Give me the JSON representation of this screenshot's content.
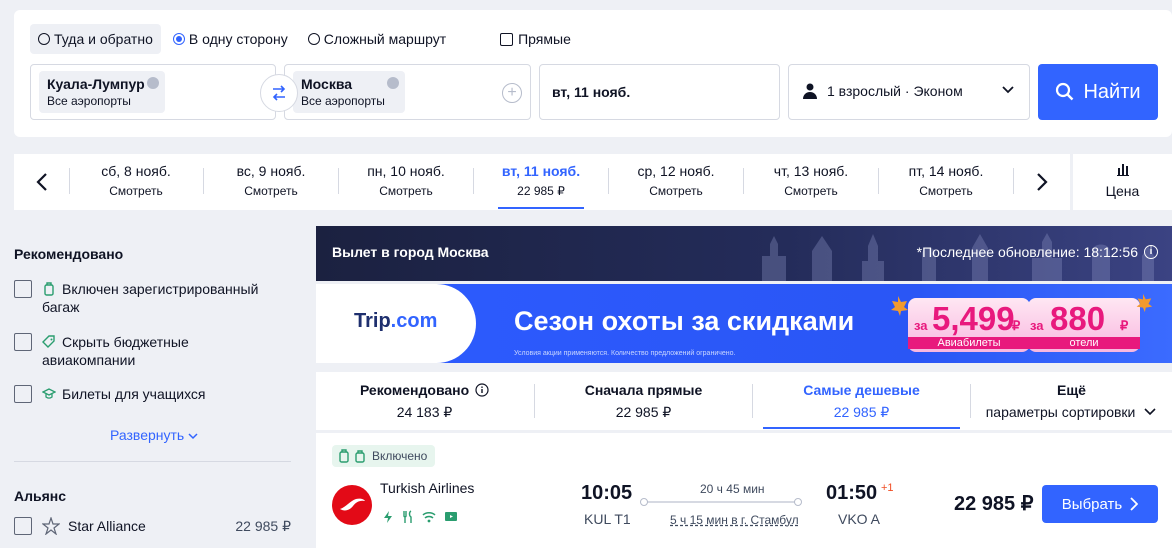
{
  "search": {
    "trip_types": [
      {
        "label": "Туда и обратно",
        "selected": true
      },
      {
        "label": "В одну сторону",
        "selected": false
      },
      {
        "label": "Сложный маршрут",
        "selected": false
      }
    ],
    "direct_label": "Прямые",
    "origin": {
      "city": "Куала-Лумпур",
      "sub": "Все аэропорты"
    },
    "destination": {
      "city": "Москва",
      "sub": "Все аэропорты"
    },
    "date": "вт, 11 нояб.",
    "passengers": "1 взрослый · Эконом",
    "find_label": "Найти"
  },
  "date_strip": {
    "items": [
      {
        "day": "сб, 8 нояб.",
        "price": "Смотреть",
        "active": false
      },
      {
        "day": "вс, 9 нояб.",
        "price": "Смотреть",
        "active": false
      },
      {
        "day": "пн, 10 нояб.",
        "price": "Смотреть",
        "active": false
      },
      {
        "day": "вт, 11 нояб.",
        "price": "22 985 ₽",
        "active": true
      },
      {
        "day": "ср, 12 нояб.",
        "price": "Смотреть",
        "active": false
      },
      {
        "day": "чт, 13 нояб.",
        "price": "Смотреть",
        "active": false
      },
      {
        "day": "пт, 14 нояб.",
        "price": "Смотреть",
        "active": false
      }
    ],
    "price_graph_label": "Цена"
  },
  "sidebar": {
    "recommended_title": "Рекомендовано",
    "filters": [
      {
        "label_line1": "Включен зарегистрированный",
        "label_line2": "багаж",
        "icon": "luggage-icon"
      },
      {
        "label_line1": "Скрыть бюджетные",
        "label_line2": "авиакомпании",
        "icon": "tag-icon"
      },
      {
        "label_line1": "Билеты для учащихся",
        "label_line2": "",
        "icon": "graduation-cap-icon"
      }
    ],
    "expand_label": "Развернуть",
    "alliance_title": "Альянс",
    "alliance": {
      "label": "Star Alliance",
      "price": "22 985 ₽",
      "icon": "star-alliance-icon"
    }
  },
  "city_banner": {
    "title": "Вылет в город Москва",
    "update": "*Последнее обновление: 18:12:56"
  },
  "ad": {
    "brand_a": "Trip",
    "brand_b": ".com",
    "headline": "Сезон охоты за  скидками",
    "fine_print": "Условия акции применяются. Количество предложений ограничено.",
    "ticket1": {
      "prefix": "за",
      "amount": "5,499",
      "currency": "₽",
      "caption": "Авиабилеты"
    },
    "ticket2": {
      "prefix": "за",
      "amount": "880",
      "currency": "₽",
      "caption": "отели"
    }
  },
  "sort": [
    {
      "title": "Рекомендовано",
      "value": "24 183 ₽",
      "active": false
    },
    {
      "title": "Сначала прямые",
      "value": "22 985 ₽",
      "active": false
    },
    {
      "title": "Самые дешевые",
      "value": "22 985 ₽",
      "active": true
    },
    {
      "title": "Ещё",
      "value": "параметры сортировки",
      "active": false
    }
  ],
  "result": {
    "included_label": "Включено",
    "airline": "Turkish Airlines",
    "dep_time": "10:05",
    "dep_airport": "KUL T1",
    "duration": "20 ч 45 мин",
    "layover": "5 ч 15 мин в г. Стамбул",
    "arr_time": "01:50",
    "arr_plus": "+1",
    "arr_airport": "VKO A",
    "price": "22 985 ₽",
    "choose_label": "Выбрать"
  },
  "colors": {
    "accent": "#3264ff",
    "text": "#0f1324",
    "background": "#eef0f5",
    "airline_red": "#e30a17",
    "promo_pink": "#e8197d"
  }
}
